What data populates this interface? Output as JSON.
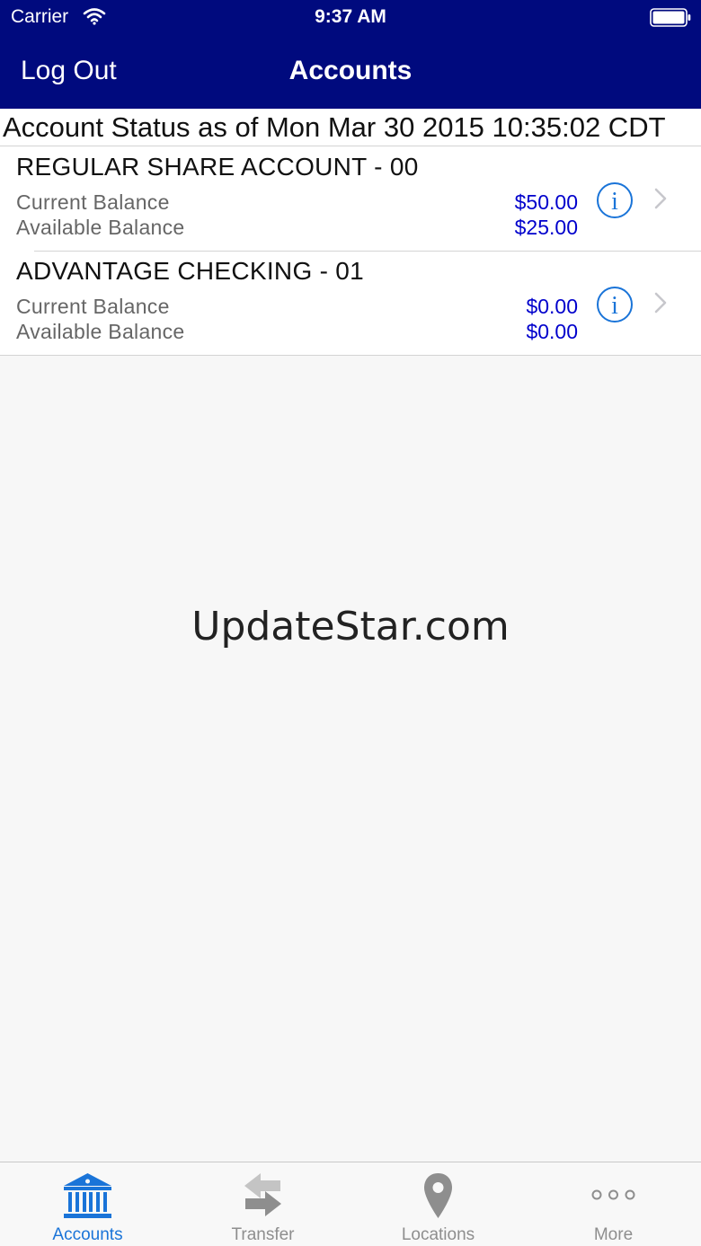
{
  "status_bar": {
    "carrier": "Carrier",
    "time": "9:37 AM"
  },
  "nav": {
    "left_button": "Log Out",
    "title": "Accounts"
  },
  "account_status": "Account Status as of Mon Mar 30 2015 10:35:02 CDT",
  "accounts": [
    {
      "name": "REGULAR SHARE ACCOUNT - 00",
      "current_label": "Current Balance",
      "current_value": "$50.00",
      "available_label": "Available Balance",
      "available_value": "$25.00"
    },
    {
      "name": "ADVANTAGE CHECKING - 01",
      "current_label": "Current Balance",
      "current_value": "$0.00",
      "available_label": "Available Balance",
      "available_value": "$0.00"
    }
  ],
  "watermark": "UpdateStar.com",
  "tabs": [
    {
      "label": "Accounts",
      "icon": "bank-icon",
      "active": true
    },
    {
      "label": "Transfer",
      "icon": "transfer-arrows-icon",
      "active": false
    },
    {
      "label": "Locations",
      "icon": "map-pin-icon",
      "active": false
    },
    {
      "label": "More",
      "icon": "more-dots-icon",
      "active": false
    }
  ],
  "colors": {
    "nav_background": "#000a7e",
    "balance_value": "#0000cc",
    "active_tab": "#1a74d8",
    "inactive_tab": "#8e8e8e"
  }
}
